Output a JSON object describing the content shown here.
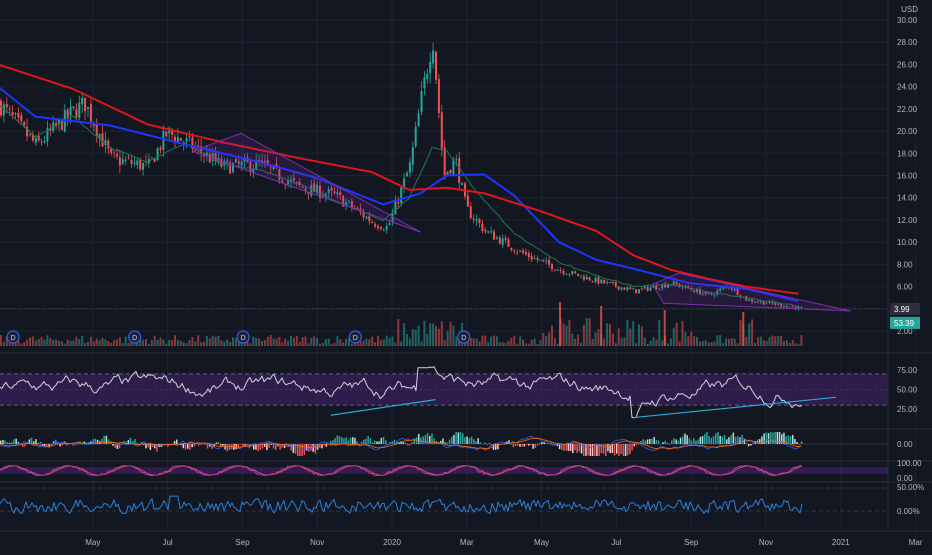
{
  "currency_label": "USD",
  "colors": {
    "background": "#131722",
    "grid": "#1f2330",
    "axis_text": "#b2b5be",
    "candle_up": "#26a69a",
    "candle_down": "#ef5350",
    "ma_long": "#e0161b",
    "ma_mid": "#1e35ff",
    "ma_short": "#1b7a55",
    "pattern": "#7b2fb0",
    "trendline": "#2ca7d6",
    "rsi_band": "#3a1f5c",
    "rsi_line": "#d1d4dc",
    "stoch_k": "#b23cb0",
    "stoch_d": "#ef5350",
    "hv_line": "#2e7fd6",
    "price_tag_bg": "#2b2f3b",
    "volume_tag_bg": "#26a69a"
  },
  "chart_data": [
    {
      "type": "candlestick",
      "panel": "price",
      "currency": "USD",
      "x_ticks": [
        "May",
        "Jul",
        "Sep",
        "Nov",
        "2020",
        "Mar",
        "May",
        "Jul",
        "Sep",
        "Nov",
        "2021",
        "Mar"
      ],
      "y_ticks": [
        "2.00",
        "4.00",
        "6.00",
        "8.00",
        "10.00",
        "12.00",
        "14.00",
        "16.00",
        "18.00",
        "20.00",
        "22.00",
        "24.00",
        "26.00",
        "28.00",
        "30.00"
      ],
      "ylim": [
        0.5,
        30.8
      ],
      "last_price": "3.99",
      "last_volume": "53.39",
      "dividend_markers": [
        "D",
        "D",
        "D",
        "D",
        "D"
      ],
      "price_path": [
        {
          "month": 0,
          "price": 22.5
        },
        {
          "month": 1,
          "price": 18.7
        },
        {
          "month": 2,
          "price": 21.8
        },
        {
          "month": 2.3,
          "price": 22.5
        },
        {
          "month": 3,
          "price": 17.5
        },
        {
          "month": 4,
          "price": 16.8
        },
        {
          "month": 4.5,
          "price": 19.9
        },
        {
          "month": 5,
          "price": 19.0
        },
        {
          "month": 6,
          "price": 16.8
        },
        {
          "month": 7,
          "price": 17.0
        },
        {
          "month": 8,
          "price": 15.0
        },
        {
          "month": 9,
          "price": 14.2
        },
        {
          "month": 10,
          "price": 11.8
        },
        {
          "month": 10.4,
          "price": 11.3
        },
        {
          "month": 10.6,
          "price": 13.2
        },
        {
          "month": 11.0,
          "price": 17.0
        },
        {
          "month": 11.3,
          "price": 23.0
        },
        {
          "month": 11.6,
          "price": 28.5
        },
        {
          "month": 11.9,
          "price": 16.0
        },
        {
          "month": 12.2,
          "price": 17.5
        },
        {
          "month": 12.5,
          "price": 13.0
        },
        {
          "month": 13.0,
          "price": 11.0
        },
        {
          "month": 14.0,
          "price": 9.0
        },
        {
          "month": 15.0,
          "price": 7.5
        },
        {
          "month": 16.0,
          "price": 6.5
        },
        {
          "month": 17.0,
          "price": 5.6
        },
        {
          "month": 18.0,
          "price": 6.3
        },
        {
          "month": 19.0,
          "price": 5.2
        },
        {
          "month": 19.5,
          "price": 6.1
        },
        {
          "month": 20.0,
          "price": 4.8
        },
        {
          "month": 21.0,
          "price": 4.3
        },
        {
          "month": 21.5,
          "price": 3.99
        }
      ],
      "ma_long": [
        {
          "month": 0,
          "price": 26.0
        },
        {
          "month": 2,
          "price": 23.8
        },
        {
          "month": 4,
          "price": 20.6
        },
        {
          "month": 6,
          "price": 19.0
        },
        {
          "month": 8,
          "price": 17.6
        },
        {
          "month": 10,
          "price": 16.3
        },
        {
          "month": 11.0,
          "price": 14.7
        },
        {
          "month": 12.0,
          "price": 14.9
        },
        {
          "month": 13.0,
          "price": 14.4
        },
        {
          "month": 14.5,
          "price": 12.8
        },
        {
          "month": 16.0,
          "price": 11.0
        },
        {
          "month": 17.0,
          "price": 8.8
        },
        {
          "month": 18.0,
          "price": 7.5
        },
        {
          "month": 19.0,
          "price": 6.7
        },
        {
          "month": 20.0,
          "price": 6.0
        },
        {
          "month": 21.5,
          "price": 5.3
        }
      ],
      "ma_mid": [
        {
          "month": 0,
          "price": 24.0
        },
        {
          "month": 1,
          "price": 21.3
        },
        {
          "month": 3,
          "price": 20.5
        },
        {
          "month": 5,
          "price": 18.8
        },
        {
          "month": 7,
          "price": 17.2
        },
        {
          "month": 8.5,
          "price": 15.8
        },
        {
          "month": 10.3,
          "price": 13.4
        },
        {
          "month": 11.3,
          "price": 14.4
        },
        {
          "month": 12.0,
          "price": 16.0
        },
        {
          "month": 13.0,
          "price": 16.1
        },
        {
          "month": 13.8,
          "price": 14.2
        },
        {
          "month": 15.0,
          "price": 10.0
        },
        {
          "month": 16.0,
          "price": 8.4
        },
        {
          "month": 17.0,
          "price": 7.6
        },
        {
          "month": 18.5,
          "price": 6.3
        },
        {
          "month": 20.0,
          "price": 5.8
        },
        {
          "month": 21.5,
          "price": 4.6
        }
      ],
      "ma_short": [
        {
          "month": 0,
          "price": 22.5
        },
        {
          "month": 1,
          "price": 19.5
        },
        {
          "month": 2,
          "price": 21.3
        },
        {
          "month": 3,
          "price": 18.5
        },
        {
          "month": 4,
          "price": 17.2
        },
        {
          "month": 5,
          "price": 18.9
        },
        {
          "month": 6,
          "price": 17.0
        },
        {
          "month": 7,
          "price": 16.5
        },
        {
          "month": 8,
          "price": 15.3
        },
        {
          "month": 9,
          "price": 13.8
        },
        {
          "month": 10.3,
          "price": 11.9
        },
        {
          "month": 11.0,
          "price": 14.0
        },
        {
          "month": 11.6,
          "price": 18.5
        },
        {
          "month": 12.0,
          "price": 18.2
        },
        {
          "month": 12.8,
          "price": 14.5
        },
        {
          "month": 13.8,
          "price": 10.8
        },
        {
          "month": 15.0,
          "price": 8.2
        },
        {
          "month": 16.0,
          "price": 7.0
        },
        {
          "month": 17.0,
          "price": 6.0
        },
        {
          "month": 18.0,
          "price": 6.2
        },
        {
          "month": 19.0,
          "price": 5.5
        },
        {
          "month": 20.0,
          "price": 5.0
        },
        {
          "month": 21.5,
          "price": 4.2
        }
      ],
      "wedge_patterns": [
        [
          {
            "month": 5.2,
            "price": 18.2
          },
          {
            "month": 6.5,
            "price": 19.8
          },
          {
            "month": 11.3,
            "price": 10.9
          }
        ],
        [
          {
            "month": 17.5,
            "price": 6.2
          },
          {
            "month": 18.2,
            "price": 7.2
          },
          {
            "month": 22.8,
            "price": 3.8
          },
          {
            "month": 17.8,
            "price": 4.5
          }
        ]
      ]
    },
    {
      "type": "line",
      "panel": "rsi",
      "y_ticks": [
        "25.00",
        "50.00",
        "75.00"
      ],
      "ylim": [
        5,
        95
      ],
      "band": [
        30,
        70
      ],
      "trendlines": [
        [
          {
            "month": 8.9,
            "value": 17
          },
          {
            "month": 11.7,
            "value": 37
          }
        ],
        [
          {
            "month": 17.0,
            "value": 14
          },
          {
            "month": 22.4,
            "value": 40
          }
        ]
      ]
    },
    {
      "type": "histogram",
      "panel": "macd",
      "y_ticks": [
        "0.00"
      ]
    },
    {
      "type": "line",
      "panel": "stochastic",
      "y_ticks": [
        "100.00",
        "0.00"
      ],
      "ylim": [
        0,
        100
      ],
      "band": [
        20,
        80
      ]
    },
    {
      "type": "line",
      "panel": "volatility",
      "y_ticks": [
        "50.00%",
        "0.00%"
      ]
    }
  ]
}
